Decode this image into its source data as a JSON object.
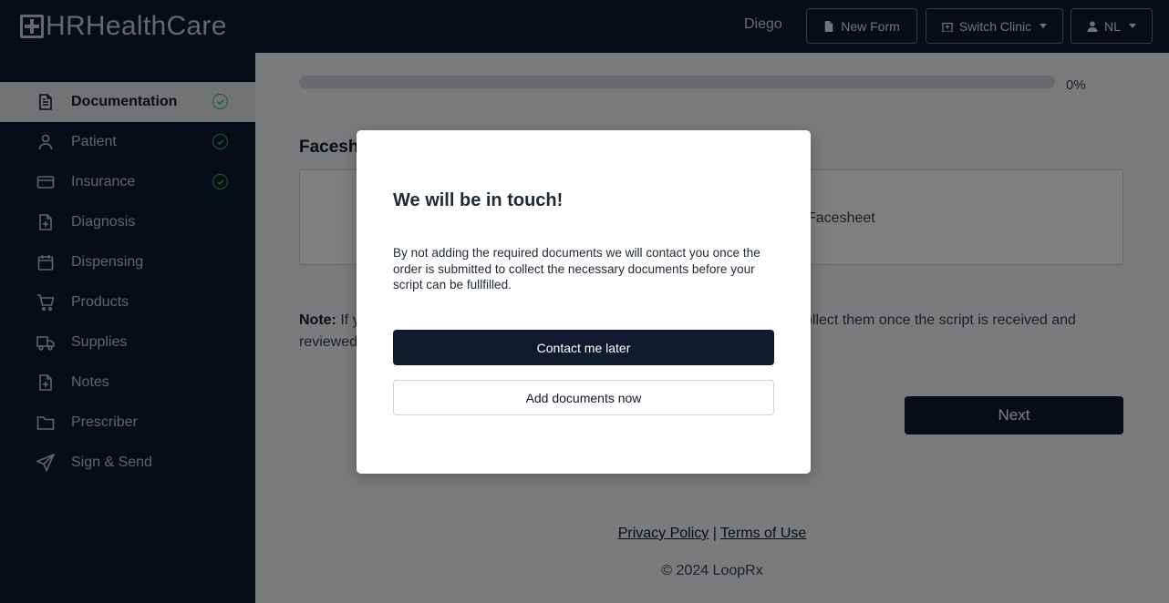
{
  "header": {
    "brand": "HRHealthCare",
    "user_name": "Diego",
    "new_form_label": "New Form",
    "switch_clinic_label": "Switch Clinic",
    "language_label": "NL"
  },
  "sidebar": {
    "items": [
      {
        "label": "Documentation",
        "icon": "document-icon",
        "active": true,
        "complete": true
      },
      {
        "label": "Patient",
        "icon": "user-icon",
        "complete": true
      },
      {
        "label": "Insurance",
        "icon": "credit-card-icon",
        "complete": true
      },
      {
        "label": "Diagnosis",
        "icon": "file-plus-icon"
      },
      {
        "label": "Dispensing",
        "icon": "calendar-icon"
      },
      {
        "label": "Products",
        "icon": "cart-icon"
      },
      {
        "label": "Supplies",
        "icon": "truck-icon"
      },
      {
        "label": "Notes",
        "icon": "file-plus-icon"
      },
      {
        "label": "Prescriber",
        "icon": "folder-icon"
      },
      {
        "label": "Sign & Send",
        "icon": "send-icon"
      }
    ]
  },
  "main": {
    "progress": {
      "value_percent": 0,
      "label": "0%"
    },
    "section_title_visible": "Facesh",
    "upload_text_visible": "Facesheet",
    "note_label": "Note:",
    "note_text_left_line1": " If y",
    "note_text_right_line1": "ollect them once the script is received and",
    "note_text_left_line2": "reviewed",
    "next_label": "Next"
  },
  "footer": {
    "privacy_label": "Privacy Policy",
    "separator": "|",
    "terms_label": "Terms of Use",
    "copyright": "© 2024 LoopRx"
  },
  "modal": {
    "title": "We will be in touch!",
    "body": "By not adding the required documents we will contact you once the order is submitted to collect the necessary documents before your script can be fullfilled.",
    "primary_label": "Contact me later",
    "secondary_label": "Add documents now"
  },
  "colors": {
    "navy": "#0f1b2d",
    "success": "#22c55e",
    "overlay": "rgba(0,0,0,0.5)"
  }
}
